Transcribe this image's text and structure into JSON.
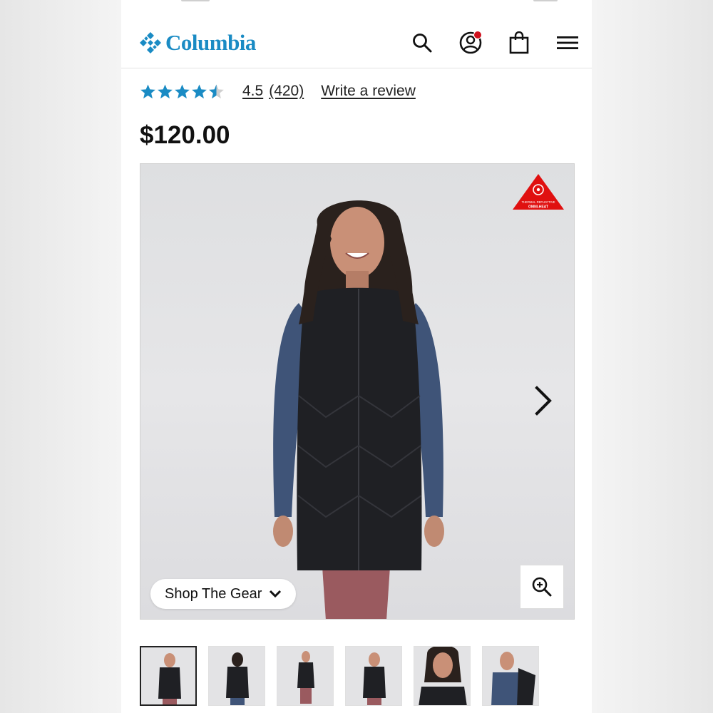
{
  "brand": {
    "name": "Columbia",
    "color": "#1a8bc4"
  },
  "header": {
    "icons": [
      "search-icon",
      "account-icon",
      "shopping-bag-icon",
      "menu-icon"
    ],
    "notification_color": "#d0101c"
  },
  "rating": {
    "stars": 4.5,
    "value": "4.5",
    "count": "(420)",
    "write_review": "Write a review",
    "star_color": "#1a8bc4"
  },
  "price": "$120.00",
  "product_image": {
    "badge_text": "OMNI-HEAT",
    "badge_subtext": "THERMAL REFLECTIVE",
    "badge_color": "#e01010",
    "shop_gear_label": "Shop The Gear"
  },
  "thumbnails": {
    "count": 6,
    "active_index": 0
  }
}
